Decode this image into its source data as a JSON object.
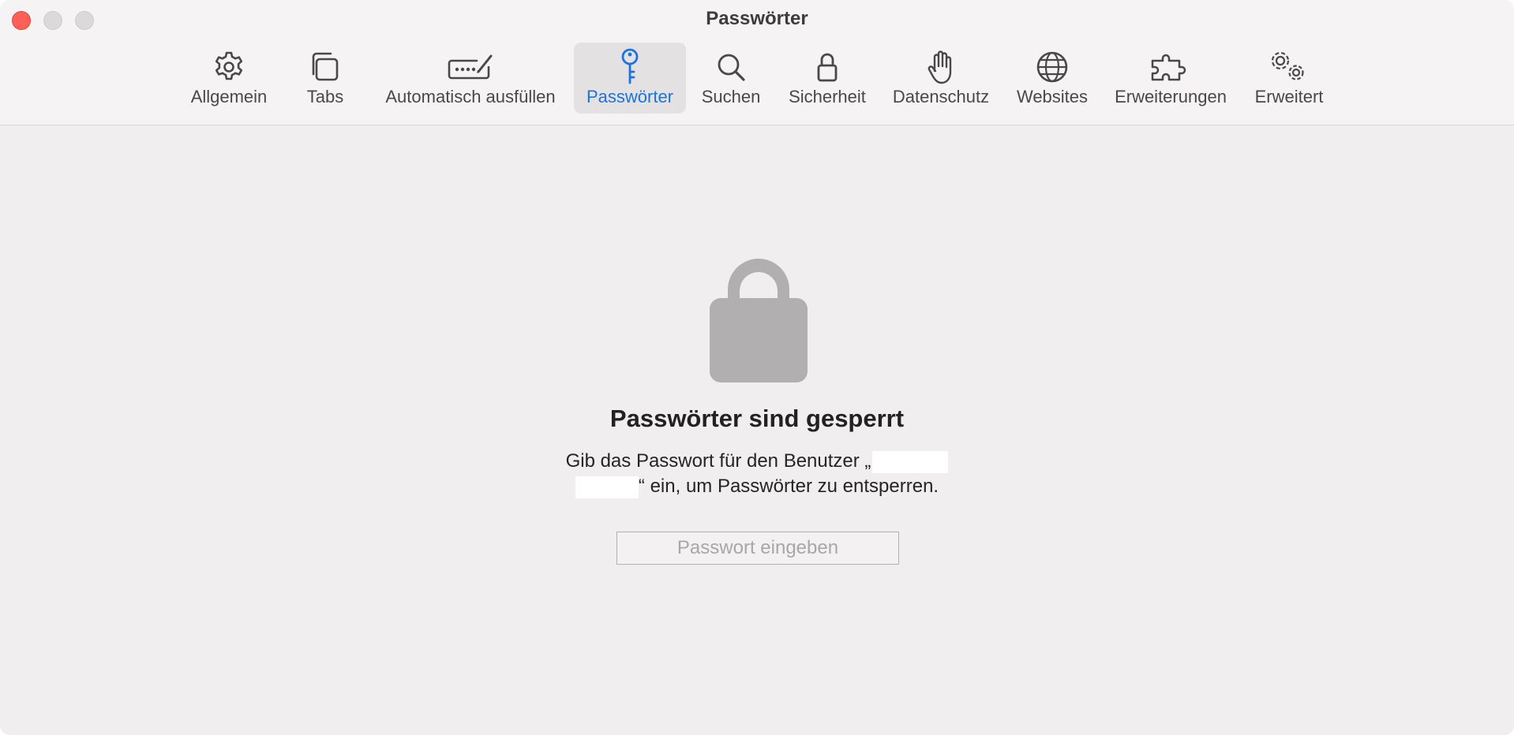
{
  "window": {
    "title": "Passwörter"
  },
  "toolbar": {
    "tabs": [
      {
        "label": "Allgemein",
        "icon": "gear-icon",
        "active": false
      },
      {
        "label": "Tabs",
        "icon": "tabs-icon",
        "active": false
      },
      {
        "label": "Automatisch ausfüllen",
        "icon": "autofill-icon",
        "active": false
      },
      {
        "label": "Passwörter",
        "icon": "key-icon",
        "active": true
      },
      {
        "label": "Suchen",
        "icon": "magnifier-icon",
        "active": false
      },
      {
        "label": "Sicherheit",
        "icon": "lock-icon",
        "active": false
      },
      {
        "label": "Datenschutz",
        "icon": "hand-icon",
        "active": false
      },
      {
        "label": "Websites",
        "icon": "globe-icon",
        "active": false
      },
      {
        "label": "Erweiterungen",
        "icon": "puzzle-icon",
        "active": false
      },
      {
        "label": "Erweitert",
        "icon": "gears-icon",
        "active": false
      }
    ]
  },
  "main": {
    "locked_title": "Passwörter sind gesperrt",
    "desc_part1": "Gib das Passwort für den Benutzer „",
    "desc_part2": "“ ein, um Passwörter zu entsperren.",
    "password_placeholder": "Passwort eingeben",
    "password_value": ""
  },
  "colors": {
    "accent": "#1a73e0",
    "close_button": "#fe5f57",
    "lock_gray": "#b1afb0",
    "background": "#f1eeef"
  }
}
